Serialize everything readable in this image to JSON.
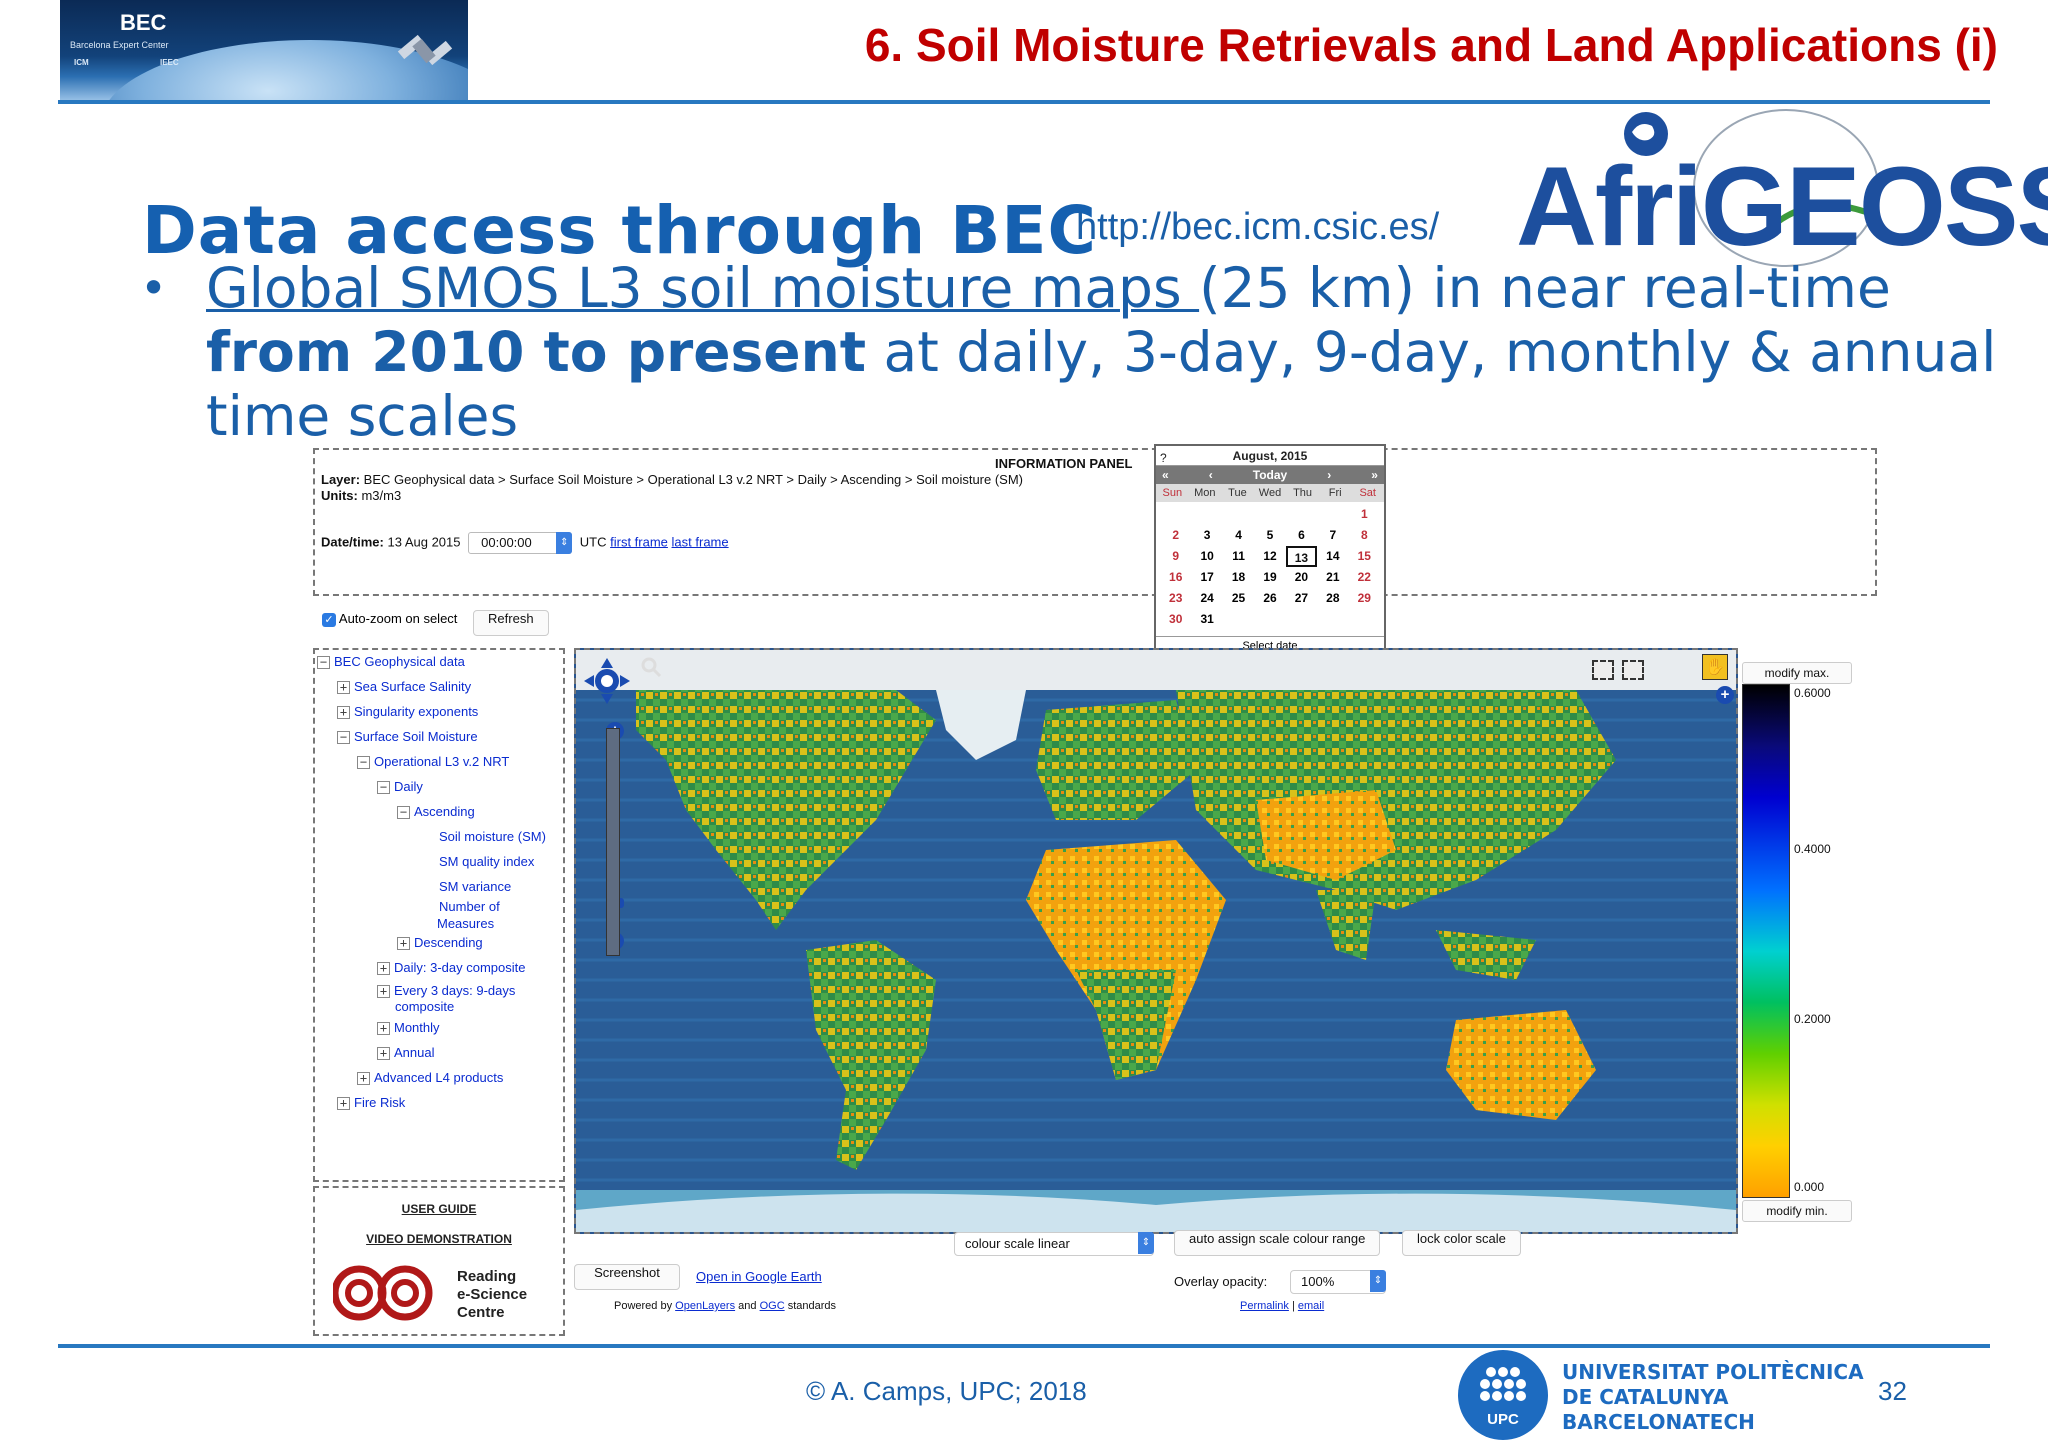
{
  "header": {
    "bec_logo": {
      "name": "BEC",
      "subtitle": "Barcelona Expert Center",
      "partner1": "ICM",
      "partner2": "IEEC"
    },
    "slide_title": "6. Soil Moisture Retrievals and Land Applications (i)"
  },
  "heading": "Data access through BEC",
  "url": "http://bec.icm.csic.es/",
  "afrigeoss_logo": "AfriGEOSS",
  "bullet": {
    "link_text": "Global SMOS L3 soil moisture maps ",
    "part1": "(25 km) in near real-time",
    "bold_text": "from 2010 to present",
    "part2": " at daily, 3-day, 9-day, monthly & annual time scales"
  },
  "screenshot": {
    "info_panel": {
      "title": "INFORMATION PANEL",
      "layer_label": "Layer:",
      "layer_value": "BEC Geophysical data > Surface Soil Moisture > Operational L3 v.2 NRT > Daily > Ascending > Soil moisture (SM)",
      "units_label": "Units:",
      "units_value": "m3/m3",
      "datetime_label": "Date/time:",
      "date_value": "13 Aug 2015",
      "time_value": "00:00:00",
      "utc": "UTC",
      "first_frame": "first frame",
      "last_frame": "last frame"
    },
    "calendar": {
      "help": "?",
      "month": "August, 2015",
      "nav_prev2": "«",
      "nav_prev": "‹",
      "today": "Today",
      "nav_next": "›",
      "nav_next2": "»",
      "weekdays": [
        "Sun",
        "Mon",
        "Tue",
        "Wed",
        "Thu",
        "Fri",
        "Sat"
      ],
      "weeks": [
        [
          "",
          "",
          "",
          "",
          "",
          "",
          "1"
        ],
        [
          "2",
          "3",
          "4",
          "5",
          "6",
          "7",
          "8"
        ],
        [
          "9",
          "10",
          "11",
          "12",
          "13",
          "14",
          "15"
        ],
        [
          "16",
          "17",
          "18",
          "19",
          "20",
          "21",
          "22"
        ],
        [
          "23",
          "24",
          "25",
          "26",
          "27",
          "28",
          "29"
        ],
        [
          "30",
          "31",
          "",
          "",
          "",
          "",
          ""
        ]
      ],
      "selected_day": "13",
      "footer": "Select date"
    },
    "auto_zoom_label": "Auto-zoom on select",
    "auto_zoom_checked": true,
    "refresh_label": "Refresh",
    "tree": {
      "root": "BEC Geophysical data",
      "sss": "Sea Surface Salinity",
      "singularity": "Singularity exponents",
      "ssm": "Surface Soil Moisture",
      "op_l3": "Operational L3 v.2 NRT",
      "daily": "Daily",
      "ascending": "Ascending",
      "sm": "Soil moisture (SM)",
      "smqi": "SM quality index",
      "smvar": "SM variance",
      "nmeas1": "Number of",
      "nmeas2": "Measures",
      "descending": "Descending",
      "daily3": "Daily: 3-day composite",
      "every3a": "Every 3 days: 9-days",
      "every3b": "composite",
      "monthly": "Monthly",
      "annual": "Annual",
      "adv_l4": "Advanced L4 products",
      "fire": "Fire Risk"
    },
    "guide": {
      "user_guide": "USER GUIDE",
      "video_demo": "VIDEO DEMONSTRATION",
      "resc1": "Reading",
      "resc2": "e-Science",
      "resc3": "Centre"
    },
    "legend": {
      "modify_max": "modify max.",
      "modify_min": "modify min.",
      "ticks": [
        "0.6000",
        "0.4000",
        "0.2000",
        "0.000"
      ]
    },
    "bottom": {
      "screenshot_btn": "Screenshot",
      "google_earth": "Open in Google Earth",
      "powered_by": "Powered by",
      "openlayers": "OpenLayers",
      "and": "and",
      "ogc": "OGC",
      "standards": "standards",
      "colour_scale": "colour scale linear",
      "auto_assign": "auto assign scale colour range",
      "lock_scale": "lock color scale",
      "overlay_label": "Overlay opacity:",
      "overlay_value": "100%",
      "permalink": "Permalink",
      "sep": "|",
      "email": "email"
    }
  },
  "footer": {
    "copyright": "© A. Camps, UPC; 2018",
    "upc_abbr": "UPC",
    "university_l1": "UNIVERSITAT POLITÈCNICA",
    "university_l2": "DE CATALUNYA",
    "university_l3": "BARCELONATECH",
    "page_number": "32"
  },
  "colors": {
    "title_red": "#c00000",
    "body_blue": "#1a5fa8",
    "rule_blue": "#2878c0",
    "link_blue": "#0a2bd0"
  }
}
